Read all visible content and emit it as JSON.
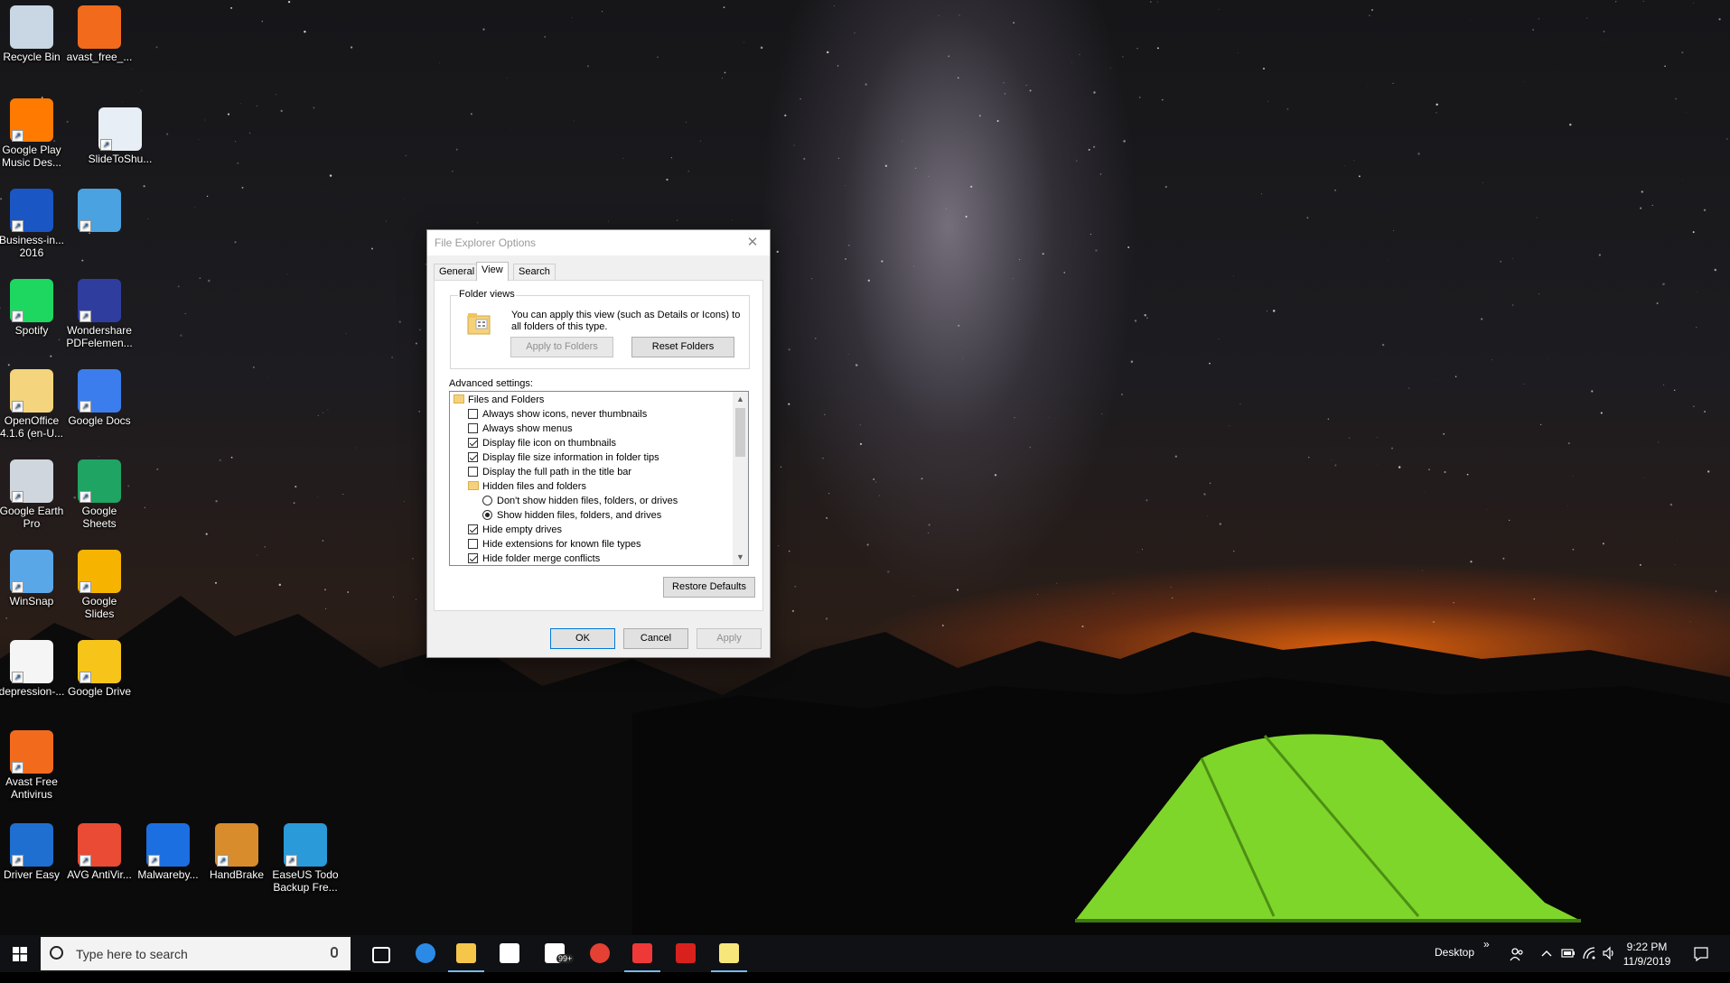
{
  "desktop": {
    "icons": [
      {
        "label": "Recycle Bin",
        "icon": "recycle-bin-icon",
        "color": "#c9d6e3"
      },
      {
        "label": "avast_free_...",
        "icon": "avast-icon",
        "color": "#f26b1d"
      },
      {
        "label": "Google Play Music Des...",
        "icon": "google-play-music-icon",
        "color": "#ff7a00"
      },
      {
        "label": "SlideToShu...",
        "icon": "slidetoshutdown-icon",
        "color": "#e8eef5"
      },
      {
        "label": "Business-in... 2016",
        "icon": "business-icon",
        "color": "#1a56c4"
      },
      {
        "label": "",
        "icon": "control-panel-icon",
        "color": "#4aa2e0"
      },
      {
        "label": "Spotify",
        "icon": "spotify-icon",
        "color": "#1ed760"
      },
      {
        "label": "Wondershare PDFelemen...",
        "icon": "pdfelement-icon",
        "color": "#2f3e9e"
      },
      {
        "label": "OpenOffice 4.1.6 (en-U...",
        "icon": "openoffice-icon",
        "color": "#f4d47c"
      },
      {
        "label": "Google Docs",
        "icon": "google-docs-icon",
        "color": "#3b7ded"
      },
      {
        "label": "Google Earth Pro",
        "icon": "google-earth-icon",
        "color": "#cfd6dd"
      },
      {
        "label": "Google Sheets",
        "icon": "google-sheets-icon",
        "color": "#1fa463"
      },
      {
        "label": "WinSnap",
        "icon": "winsnap-icon",
        "color": "#5aa7e8"
      },
      {
        "label": "Google Slides",
        "icon": "google-slides-icon",
        "color": "#f6b400"
      },
      {
        "label": "depression-...",
        "icon": "document-icon",
        "color": "#f5f5f5"
      },
      {
        "label": "Google Drive",
        "icon": "google-drive-icon",
        "color": "#f7c51a"
      },
      {
        "label": "Avast Free Antivirus",
        "icon": "avast-antivirus-icon",
        "color": "#f26b1d"
      },
      {
        "label": "Driver Easy",
        "icon": "driver-easy-icon",
        "color": "#1f6fd1"
      },
      {
        "label": "AVG AntiVir...",
        "icon": "avg-icon",
        "color": "#e94b35"
      },
      {
        "label": "Malwareby...",
        "icon": "malwarebytes-icon",
        "color": "#1c6fe0"
      },
      {
        "label": "HandBrake",
        "icon": "handbrake-icon",
        "color": "#d98c2b"
      },
      {
        "label": "EaseUS Todo Backup Fre...",
        "icon": "easeus-icon",
        "color": "#2a9ad8"
      }
    ]
  },
  "dialog": {
    "title": "File Explorer Options",
    "tabs": [
      "General",
      "View",
      "Search"
    ],
    "active_tab": "View",
    "folder_views": {
      "label": "Folder views",
      "description": "You can apply this view (such as Details or Icons) to all folders of this type.",
      "apply_button": "Apply to Folders",
      "reset_button": "Reset Folders"
    },
    "advanced_label": "Advanced settings:",
    "settings": [
      {
        "type": "folder",
        "indent": 0,
        "label": "Files and Folders"
      },
      {
        "type": "check",
        "indent": 1,
        "checked": false,
        "label": "Always show icons, never thumbnails"
      },
      {
        "type": "check",
        "indent": 1,
        "checked": false,
        "label": "Always show menus"
      },
      {
        "type": "check",
        "indent": 1,
        "checked": true,
        "label": "Display file icon on thumbnails"
      },
      {
        "type": "check",
        "indent": 1,
        "checked": true,
        "label": "Display file size information in folder tips"
      },
      {
        "type": "check",
        "indent": 1,
        "checked": false,
        "label": "Display the full path in the title bar"
      },
      {
        "type": "folder",
        "indent": 1,
        "label": "Hidden files and folders"
      },
      {
        "type": "radio",
        "indent": 2,
        "checked": false,
        "label": "Don't show hidden files, folders, or drives"
      },
      {
        "type": "radio",
        "indent": 2,
        "checked": true,
        "label": "Show hidden files, folders, and drives"
      },
      {
        "type": "check",
        "indent": 1,
        "checked": true,
        "label": "Hide empty drives"
      },
      {
        "type": "check",
        "indent": 1,
        "checked": false,
        "label": "Hide extensions for known file types"
      },
      {
        "type": "check",
        "indent": 1,
        "checked": true,
        "label": "Hide folder merge conflicts"
      }
    ],
    "restore_button": "Restore Defaults",
    "ok_button": "OK",
    "cancel_button": "Cancel",
    "apply_button": "Apply",
    "close_glyph": "✕"
  },
  "taskbar": {
    "search_placeholder": "Type here to search",
    "apps": [
      {
        "name": "task-view-icon",
        "active": false
      },
      {
        "name": "edge-icon",
        "active": false
      },
      {
        "name": "file-explorer-icon",
        "active": true
      },
      {
        "name": "store-icon",
        "active": false
      },
      {
        "name": "mail-icon",
        "active": false,
        "badge": "99+"
      },
      {
        "name": "chrome-icon",
        "active": false
      },
      {
        "name": "vivaldi-icon",
        "active": true
      },
      {
        "name": "app-red-icon",
        "active": false
      },
      {
        "name": "sticky-notes-icon",
        "active": true
      }
    ],
    "desktop_label": "Desktop",
    "chevron": "»",
    "time": "9:22 PM",
    "date": "11/9/2019",
    "accent": "#76b9ed"
  }
}
